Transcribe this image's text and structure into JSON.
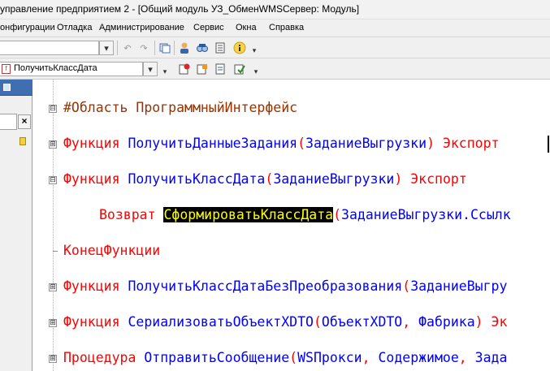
{
  "window": {
    "title": "управление предприятием 2 - [Общий модуль УЗ_ОбменWMSСервер: Модуль]"
  },
  "menu": {
    "items": [
      "онфигурации",
      "Отладка",
      "Администрирование",
      "Сервис",
      "Окна",
      "Справка"
    ]
  },
  "toolbar": {
    "method_selector_value": "ПолучитьКлассДата"
  },
  "panel": {
    "close_label": "×"
  },
  "code": {
    "lines": [
      {
        "kind": "region",
        "fold": "⊟",
        "text": "#Область ПрограммныйИнтерфейс"
      },
      {
        "kind": "func",
        "fold": "⊞",
        "kw": "Функция",
        "name": "ПолучитьДанныеЗадания",
        "open": "(",
        "params": "ЗаданиеВыгрузки",
        "close": ")",
        "export": "Экспорт"
      },
      {
        "kind": "func",
        "fold": "⊟",
        "kw": "Функция",
        "name": "ПолучитьКлассДата",
        "open": "(",
        "params": "ЗаданиеВыгрузки",
        "close": ")",
        "export": "Экспорт"
      },
      {
        "kind": "return",
        "kw": "Возврат",
        "call": "СформироватьКлассДата",
        "open": "(",
        "arg": "ЗаданиеВыгрузки.Ссылк"
      },
      {
        "kind": "end",
        "text": "КонецФункции"
      },
      {
        "kind": "func",
        "fold": "⊞",
        "kw": "Функция",
        "name": "ПолучитьКлассДатаБезПреобразования",
        "open": "(",
        "params": "ЗаданиеВыгру"
      },
      {
        "kind": "func",
        "fold": "⊞",
        "kw": "Функция",
        "name": "СериализоватьОбъектXDTO",
        "open": "(",
        "params": "ОбъектXDTO",
        "comma": ",",
        "params2": "Фабрика",
        "close": ")",
        "export": "Эк"
      },
      {
        "kind": "proc",
        "fold": "⊞",
        "kw": "Процедура",
        "name": "ОтправитьСообщение",
        "open": "(",
        "params": "WSПрокси",
        "comma": ",",
        "params2": "Содержимое",
        "comma2": ",",
        "params3": "Зада"
      }
    ]
  }
}
